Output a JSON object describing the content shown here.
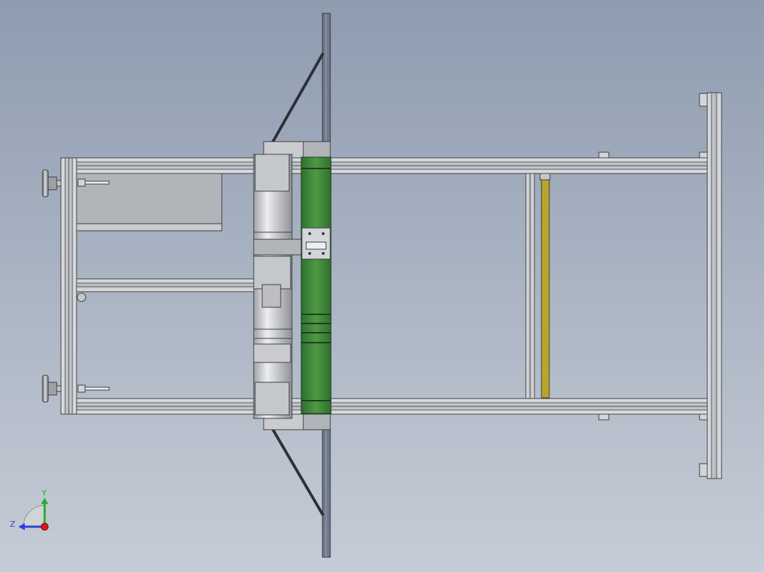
{
  "viewport": {
    "background_top": "#8e9cb0",
    "background_bottom": "#c6ccd6"
  },
  "colors": {
    "frame_aluminum": "#c4c7cb",
    "frame_edge": "#3a3d42",
    "roller_green": "#3e8a3a",
    "roller_green_dark": "#2f6e2d",
    "strip_yellow": "#b9a52a",
    "motor_gray": "#bdbec2",
    "brace_dark": "#2d3036",
    "panel_gray": "#b1b4b8"
  },
  "triad": {
    "y_label": "Y",
    "z_label": "Z",
    "y_color": "#1fae2a",
    "z_color": "#2b3fd6",
    "x_color": "#d81b1b"
  }
}
